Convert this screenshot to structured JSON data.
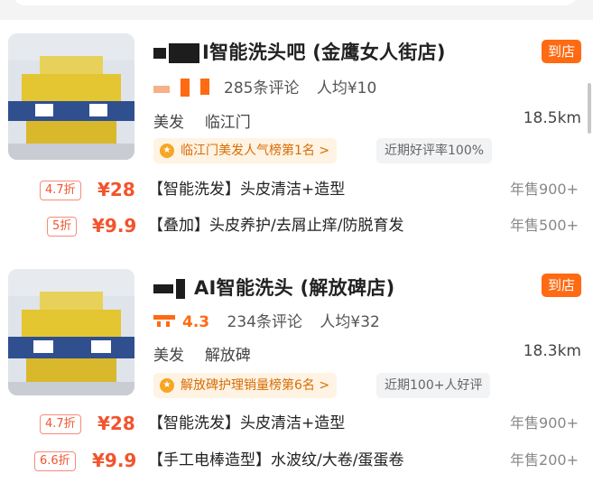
{
  "colors": {
    "accent": "#ff6a13",
    "price": "#f2542d",
    "rank_text": "#d76d05"
  },
  "listings": [
    {
      "title": "I智能洗头吧 (金鹰女人街店)",
      "store_badge": "到店",
      "reviews": "285条评论",
      "avg_price": "人均¥10",
      "category": "美发",
      "area": "临江门",
      "distance": "18.5km",
      "rank": "临江门美发人气榜第1名 >",
      "praise": "近期好评率100%",
      "deals": [
        {
          "discount": "4.7折",
          "price": "¥28",
          "title": "【智能洗发】头皮清洁+造型",
          "sold": "年售900+"
        },
        {
          "discount": "5折",
          "price": "¥9.9",
          "title": "【叠加】头皮养护/去屑止痒/防脱育发",
          "sold": "年售500+"
        }
      ]
    },
    {
      "title": "AI智能洗头 (解放碑店)",
      "store_badge": "到店",
      "rating": "4.3",
      "reviews": "234条评论",
      "avg_price": "人均¥32",
      "category": "美发",
      "area": "解放碑",
      "distance": "18.3km",
      "rank": "解放碑护理销量榜第6名 >",
      "praise": "近期100+人好评",
      "deals": [
        {
          "discount": "4.7折",
          "price": "¥28",
          "title": "【智能洗发】头皮清洁+造型",
          "sold": "年售900+"
        },
        {
          "discount": "6.6折",
          "price": "¥9.9",
          "title": "【手工电棒造型】水波纹/大卷/蛋蛋卷",
          "sold": "年售200+"
        }
      ]
    }
  ]
}
